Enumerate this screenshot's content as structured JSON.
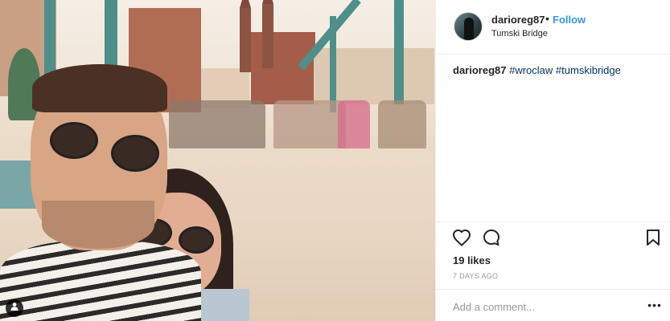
{
  "post": {
    "photo_alt": "",
    "user": {
      "username": "darioreg87",
      "separator": "•",
      "follow_label": "Follow",
      "location": "Tumski Bridge"
    },
    "caption": {
      "username": "darioreg87",
      "hashtags": [
        "#wroclaw",
        "#tumskibridge"
      ]
    },
    "likes_text": "19 likes",
    "time_text": "7 DAYS AGO",
    "comment": {
      "placeholder": "Add a comment...",
      "more_label": "•••"
    }
  },
  "icons": {
    "user_tag": "user-tag-icon",
    "like": "heart-icon",
    "comment": "comment-icon",
    "save": "bookmark-icon",
    "more": "more-options-icon"
  },
  "colors": {
    "follow": "#3897f0",
    "hashtag": "#003569",
    "text": "#262626",
    "muted": "#999999",
    "border": "#efefef"
  }
}
